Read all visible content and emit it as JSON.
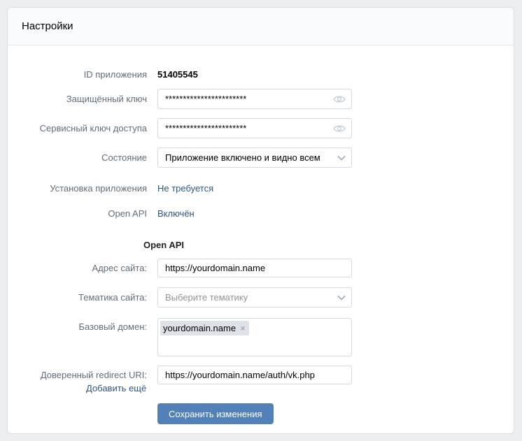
{
  "header": {
    "title": "Настройки"
  },
  "app": {
    "id_label": "ID приложения",
    "id_value": "51405545",
    "secret_label": "Защищённый ключ",
    "secret_value": "***********************",
    "service_label": "Сервисный ключ доступа",
    "service_value": "***********************",
    "state_label": "Состояние",
    "state_value": "Приложение включено и видно всем",
    "install_label": "Установка приложения",
    "install_value": "Не требуется",
    "openapi_label": "Open API",
    "openapi_value": "Включён"
  },
  "openapi": {
    "heading": "Open API",
    "site_label": "Адрес сайта:",
    "site_value": "https://yourdomain.name",
    "topic_label": "Тематика сайта:",
    "topic_placeholder": "Выберите тематику",
    "domain_label": "Базовый домен:",
    "domain_token": "yourdomain.name",
    "domain_remove": "×",
    "redirect_label": "Доверенный redirect URI:",
    "redirect_value": "https://yourdomain.name/auth/vk.php",
    "add_more": "Добавить ещё"
  },
  "actions": {
    "save_label": "Сохранить изменения"
  },
  "colors": {
    "accent": "#5181b8",
    "link": "#2a5885",
    "label": "#626d7a"
  },
  "icons": {
    "reveal": "eye-icon",
    "dropdown": "chevron-down-icon"
  }
}
